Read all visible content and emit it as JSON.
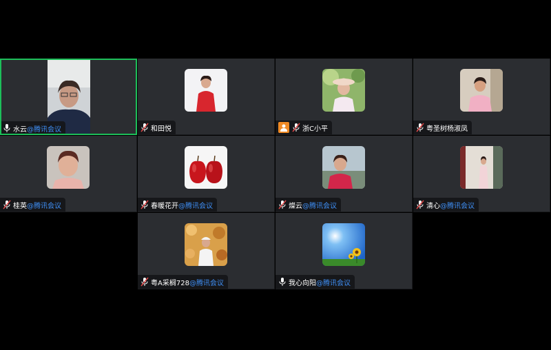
{
  "participants": [
    {
      "name": "水云",
      "suffix": "@腾讯会议",
      "status": "speaking",
      "avatar": "video-feed"
    },
    {
      "name": "和田悦",
      "suffix": "",
      "status": "muted",
      "avatar": "woman-red-dress"
    },
    {
      "name": "浙C小平",
      "suffix": "",
      "status": "video-off",
      "avatar": "woman-with-hat"
    },
    {
      "name": "粤圣树杨淑凤",
      "suffix": "",
      "status": "muted",
      "avatar": "woman-pink-shirt"
    },
    {
      "name": "桂英",
      "suffix": "@腾讯会议",
      "status": "muted",
      "avatar": "elderly-woman"
    },
    {
      "name": "春暖花开",
      "suffix": "@腾讯会议",
      "status": "muted",
      "avatar": "two-apples"
    },
    {
      "name": "燦云",
      "suffix": "@腾讯会议",
      "status": "muted",
      "avatar": "woman-by-lake"
    },
    {
      "name": "清心",
      "suffix": "@腾讯会议",
      "status": "muted",
      "avatar": "woman-by-tree"
    },
    {
      "name": "粤A采榈728",
      "suffix": "@腾讯会议",
      "status": "muted",
      "avatar": "woman-autumn-leaves"
    },
    {
      "name": "我心向阳",
      "suffix": "@腾讯会议",
      "status": "muted",
      "avatar": "sunflower-sky"
    }
  ],
  "colors": {
    "tile_bg": "#2b2d31",
    "active_border": "#1dbf5a",
    "suffix_text": "#3f8ff5",
    "muted_mic": "#e04848",
    "user_icon_bg": "#f08a24"
  }
}
